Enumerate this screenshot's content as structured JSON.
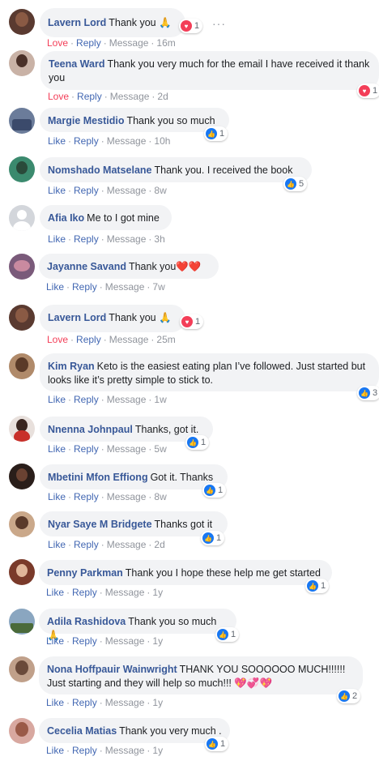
{
  "actions": {
    "like": "Like",
    "love": "Love",
    "reply": "Reply",
    "message": "Message",
    "sep": "·"
  },
  "comments": [
    {
      "author": "Lavern Lord",
      "text": "Thank you 🙏",
      "reaction_type": "love",
      "reaction_count": "1",
      "action": "Love",
      "time": "16m"
    },
    {
      "author": "Teena Ward",
      "text": "Thank you very much for the email I have received it thank you",
      "reaction_type": "love",
      "reaction_count": "1",
      "action": "Love",
      "time": "2d"
    },
    {
      "author": "Margie Mestidio",
      "text": "Thank you so much",
      "reaction_type": "like",
      "reaction_count": "1",
      "action": "Like",
      "time": "10h"
    },
    {
      "author": "Nomshado Matselane",
      "text": "Thank you. I received the book",
      "reaction_type": "like",
      "reaction_count": "5",
      "action": "Like",
      "time": "8w"
    },
    {
      "author": "Afia Iko",
      "text": "Me to I got mine",
      "reaction_type": "none",
      "reaction_count": "",
      "action": "Like",
      "time": "3h"
    },
    {
      "author": "Jayanne Savand",
      "text": "Thank you❤️❤️",
      "reaction_type": "none",
      "reaction_count": "",
      "action": "Like",
      "time": "7w"
    },
    {
      "author": "Lavern Lord",
      "text": "Thank you 🙏",
      "reaction_type": "love",
      "reaction_count": "1",
      "action": "Love",
      "time": "25m"
    },
    {
      "author": "Kim Ryan",
      "text": "Keto is the easiest eating plan I’ve followed. Just started but looks like it’s pretty simple to stick to.",
      "reaction_type": "like",
      "reaction_count": "3",
      "action": "Like",
      "time": "1w"
    },
    {
      "author": "Nnenna Johnpaul",
      "text": "Thanks, got it.",
      "reaction_type": "like",
      "reaction_count": "1",
      "action": "Like",
      "time": "5w"
    },
    {
      "author": "Mbetini Mfon Effiong",
      "text": "Got it. Thanks",
      "reaction_type": "like",
      "reaction_count": "1",
      "action": "Like",
      "time": "8w"
    },
    {
      "author": "Nyar Saye M Bridgete",
      "text": "Thanks got it",
      "reaction_type": "like",
      "reaction_count": "1",
      "action": "Like",
      "time": "2d"
    },
    {
      "author": "Penny Parkman",
      "text": "Thank you I hope these help me get started",
      "reaction_type": "like",
      "reaction_count": "1",
      "action": "Like",
      "time": "1y"
    },
    {
      "author": "Adila Rashidova",
      "text": "Thank you so much🙏",
      "reaction_type": "like",
      "reaction_count": "1",
      "action": "Like",
      "time": "1y"
    },
    {
      "author": "Nona Hoffpauir Wainwright",
      "text": "THANK YOU SOOOOOO MUCH!!!!!! Just starting and they will help so much!!! 💖💞💖",
      "reaction_type": "like",
      "reaction_count": "2",
      "action": "Like",
      "time": "1y"
    },
    {
      "author": "Cecelia Matias",
      "text": "Thank you very much .",
      "reaction_type": "like",
      "reaction_count": "1",
      "action": "Like",
      "time": "1y"
    }
  ],
  "colors": {
    "author": "#385898",
    "like": "#4267b2",
    "love": "#f33e58",
    "bubble": "#f2f3f5"
  },
  "icons": {
    "like": "thumbs-up-icon",
    "love": "heart-icon",
    "more": "more-options-icon"
  }
}
